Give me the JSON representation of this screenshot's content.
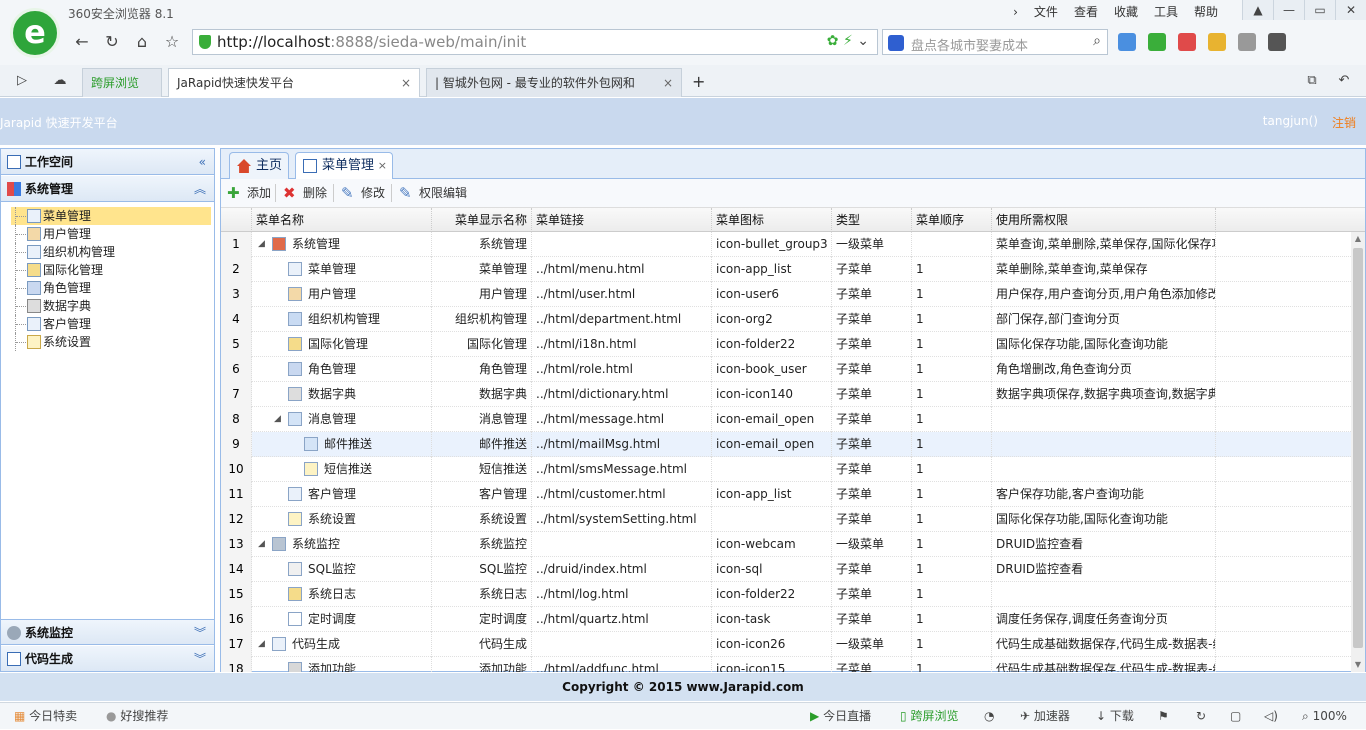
{
  "browser": {
    "title": "360安全浏览器 8.1",
    "menu": [
      "文件",
      "查看",
      "收藏",
      "工具",
      "帮助"
    ],
    "url_host": "http://localhost",
    "url_rest": ":8888/sieda-web/main/init",
    "search_placeholder": "盘点各城市娶妻成本",
    "tabs": [
      {
        "label": "跨屏浏览"
      },
      {
        "label": "JaRapid快速快发平台",
        "close": "×"
      },
      {
        "label": "| 智城外包网 - 最专业的软件外包网和",
        "close": "×"
      },
      {
        "label": "+"
      }
    ],
    "status_left": [
      "今日特卖",
      "好搜推荐"
    ],
    "status_right": [
      "今日直播",
      "跨屏浏览",
      "加速器",
      "下载",
      "100%"
    ]
  },
  "app": {
    "title": "Jarapid 快速开发平台",
    "user": "tangjun()",
    "logout": "注销",
    "footer": "Copyright © 2015 www.Jarapid.com"
  },
  "sidebar": {
    "sections": {
      "workspace": "工作空间",
      "system": "系统管理",
      "monitor": "系统监控",
      "codegen": "代码生成"
    },
    "items": [
      "菜单管理",
      "用户管理",
      "组织机构管理",
      "国际化管理",
      "角色管理",
      "数据字典",
      "客户管理",
      "系统设置"
    ]
  },
  "main": {
    "tabs": [
      "主页",
      "菜单管理"
    ],
    "tab_close": "×",
    "toolbar": {
      "add": "添加",
      "delete": "删除",
      "edit": "修改",
      "perm": "权限编辑"
    },
    "columns": [
      "菜单名称",
      "菜单显示名称",
      "菜单链接",
      "菜单图标",
      "类型",
      "菜单顺序",
      "使用所需权限"
    ],
    "rows": [
      {
        "n": "1",
        "name": "系统管理",
        "display": "系统管理",
        "link": "",
        "icon": "icon-bullet_group3",
        "type": "一级菜单",
        "order": "",
        "perm": "菜单查询,菜单删除,菜单保存,国际化保存功"
      },
      {
        "n": "2",
        "name": "菜单管理",
        "display": "菜单管理",
        "link": "../html/menu.html",
        "icon": "icon-app_list",
        "type": "子菜单",
        "order": "1",
        "perm": "菜单删除,菜单查询,菜单保存"
      },
      {
        "n": "3",
        "name": "用户管理",
        "display": "用户管理",
        "link": "../html/user.html",
        "icon": "icon-user6",
        "type": "子菜单",
        "order": "1",
        "perm": "用户保存,用户查询分页,用户角色添加修改"
      },
      {
        "n": "4",
        "name": "组织机构管理",
        "display": "组织机构管理",
        "link": "../html/department.html",
        "icon": "icon-org2",
        "type": "子菜单",
        "order": "1",
        "perm": "部门保存,部门查询分页"
      },
      {
        "n": "5",
        "name": "国际化管理",
        "display": "国际化管理",
        "link": "../html/i18n.html",
        "icon": "icon-folder22",
        "type": "子菜单",
        "order": "1",
        "perm": "国际化保存功能,国际化查询功能"
      },
      {
        "n": "6",
        "name": "角色管理",
        "display": "角色管理",
        "link": "../html/role.html",
        "icon": "icon-book_user",
        "type": "子菜单",
        "order": "1",
        "perm": "角色增删改,角色查询分页"
      },
      {
        "n": "7",
        "name": "数据字典",
        "display": "数据字典",
        "link": "../html/dictionary.html",
        "icon": "icon-icon140",
        "type": "子菜单",
        "order": "1",
        "perm": "数据字典项保存,数据字典项查询,数据字典"
      },
      {
        "n": "8",
        "name": "消息管理",
        "display": "消息管理",
        "link": "../html/message.html",
        "icon": "icon-email_open",
        "type": "子菜单",
        "order": "1",
        "perm": ""
      },
      {
        "n": "9",
        "name": "邮件推送",
        "display": "邮件推送",
        "link": "../html/mailMsg.html",
        "icon": "icon-email_open",
        "type": "子菜单",
        "order": "1",
        "perm": ""
      },
      {
        "n": "10",
        "name": "短信推送",
        "display": "短信推送",
        "link": "../html/smsMessage.html",
        "icon": "",
        "type": "子菜单",
        "order": "1",
        "perm": ""
      },
      {
        "n": "11",
        "name": "客户管理",
        "display": "客户管理",
        "link": "../html/customer.html",
        "icon": "icon-app_list",
        "type": "子菜单",
        "order": "1",
        "perm": "客户保存功能,客户查询功能"
      },
      {
        "n": "12",
        "name": "系统设置",
        "display": "系统设置",
        "link": "../html/systemSetting.html",
        "icon": "",
        "type": "子菜单",
        "order": "1",
        "perm": "国际化保存功能,国际化查询功能"
      },
      {
        "n": "13",
        "name": "系统监控",
        "display": "系统监控",
        "link": "",
        "icon": "icon-webcam",
        "type": "一级菜单",
        "order": "1",
        "perm": "DRUID监控查看"
      },
      {
        "n": "14",
        "name": "SQL监控",
        "display": "SQL监控",
        "link": "../druid/index.html",
        "icon": "icon-sql",
        "type": "子菜单",
        "order": "1",
        "perm": "DRUID监控查看"
      },
      {
        "n": "15",
        "name": "系统日志",
        "display": "系统日志",
        "link": "../html/log.html",
        "icon": "icon-folder22",
        "type": "子菜单",
        "order": "1",
        "perm": ""
      },
      {
        "n": "16",
        "name": "定时调度",
        "display": "定时调度",
        "link": "../html/quartz.html",
        "icon": "icon-task",
        "type": "子菜单",
        "order": "1",
        "perm": "调度任务保存,调度任务查询分页"
      },
      {
        "n": "17",
        "name": "代码生成",
        "display": "代码生成",
        "link": "",
        "icon": "icon-icon26",
        "type": "一级菜单",
        "order": "1",
        "perm": "代码生成基础数据保存,代码生成-数据表-维"
      },
      {
        "n": "18",
        "name": "添加功能",
        "display": "添加功能",
        "link": "../html/addfunc.html",
        "icon": "icon-icon15",
        "type": "子菜单",
        "order": "1",
        "perm": "代码生成基础数据保存,代码生成-数据表-维"
      }
    ]
  }
}
